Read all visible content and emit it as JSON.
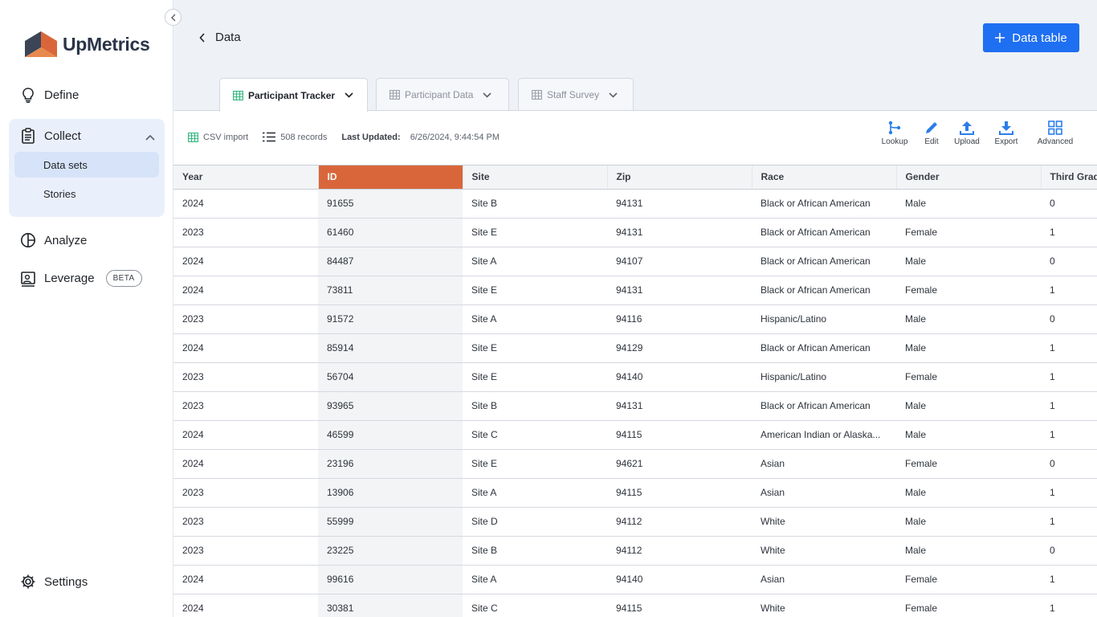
{
  "app": {
    "brand": "UpMetrics"
  },
  "sidebar": {
    "define": "Define",
    "collect": "Collect",
    "collect_items": [
      "Data sets",
      "Stories"
    ],
    "analyze": "Analyze",
    "leverage": "Leverage",
    "beta": "BETA",
    "settings": "Settings"
  },
  "header": {
    "back_label": "Data",
    "add_button": "Data table"
  },
  "tabs": [
    {
      "label": "Participant Tracker",
      "active": true
    },
    {
      "label": "Participant Data",
      "active": false
    },
    {
      "label": "Staff Survey",
      "active": false
    }
  ],
  "meta": {
    "source": "CSV import",
    "records": "508 records",
    "updated_label": "Last Updated:",
    "updated_value": "6/26/2024, 9:44:54 PM"
  },
  "toolbar": [
    "Lookup",
    "Edit",
    "Upload",
    "Export",
    "Advanced"
  ],
  "colors": {
    "accent": "#1f6ff2",
    "selected_column": "#d9663a",
    "collect_bg": "#eaf0fb"
  },
  "table": {
    "columns": [
      "Year",
      "ID",
      "Site",
      "Zip",
      "Race",
      "Gender",
      "Third Grade"
    ],
    "rows": [
      [
        "2024",
        "91655",
        "Site B",
        "94131",
        "Black or African American",
        "Male",
        "0"
      ],
      [
        "2023",
        "61460",
        "Site E",
        "94131",
        "Black or African American",
        "Female",
        "1"
      ],
      [
        "2024",
        "84487",
        "Site A",
        "94107",
        "Black or African American",
        "Male",
        "0"
      ],
      [
        "2024",
        "73811",
        "Site E",
        "94131",
        "Black or African American",
        "Female",
        "1"
      ],
      [
        "2023",
        "91572",
        "Site A",
        "94116",
        "Hispanic/Latino",
        "Male",
        "0"
      ],
      [
        "2024",
        "85914",
        "Site E",
        "94129",
        "Black or African American",
        "Male",
        "1"
      ],
      [
        "2023",
        "56704",
        "Site E",
        "94140",
        "Hispanic/Latino",
        "Female",
        "1"
      ],
      [
        "2023",
        "93965",
        "Site B",
        "94131",
        "Black or African American",
        "Male",
        "1"
      ],
      [
        "2024",
        "46599",
        "Site C",
        "94115",
        "American Indian or Alaska...",
        "Male",
        "1"
      ],
      [
        "2024",
        "23196",
        "Site E",
        "94621",
        "Asian",
        "Female",
        "0"
      ],
      [
        "2023",
        "13906",
        "Site A",
        "94115",
        "Asian",
        "Male",
        "1"
      ],
      [
        "2023",
        "55999",
        "Site D",
        "94112",
        "White",
        "Male",
        "1"
      ],
      [
        "2023",
        "23225",
        "Site B",
        "94112",
        "White",
        "Male",
        "0"
      ],
      [
        "2024",
        "99616",
        "Site A",
        "94140",
        "Asian",
        "Female",
        "1"
      ],
      [
        "2024",
        "30381",
        "Site C",
        "94115",
        "White",
        "Female",
        "1"
      ]
    ]
  }
}
